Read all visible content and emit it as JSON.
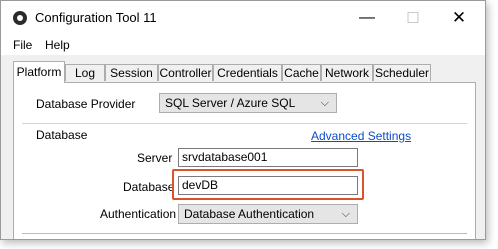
{
  "window": {
    "title": "Configuration Tool 11"
  },
  "icons": {
    "app": "app-circle-icon",
    "minimize": "minimize-icon",
    "maximize": "maximize-icon",
    "close": "close-icon",
    "dropdown": "chevron-down-icon"
  },
  "titlebar_glyphs": {
    "minimize": "—",
    "maximize": "☐",
    "close": "✕",
    "chevron": "⌵"
  },
  "menu": {
    "file": "File",
    "help": "Help"
  },
  "tabs": [
    "Platform",
    "Log",
    "Session",
    "Controller",
    "Credentials",
    "Cache",
    "Network",
    "Scheduler"
  ],
  "active_tab": "Platform",
  "platform": {
    "provider_label": "Database Provider",
    "provider_value": "SQL Server / Azure SQL",
    "group_label": "Database",
    "advanced_link": "Advanced Settings",
    "server_label": "Server",
    "server_value": "srvdatabase001",
    "database_label": "Database",
    "database_value": "devDB",
    "auth_label": "Authentication",
    "auth_value": "Database Authentication"
  },
  "colors": {
    "highlight": "#d9532b",
    "link": "#0b4ccc"
  }
}
